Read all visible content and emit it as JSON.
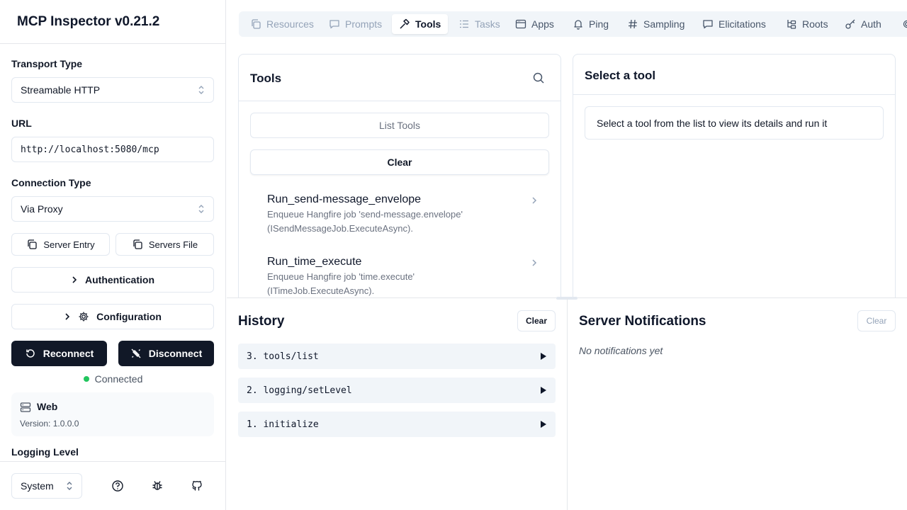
{
  "sidebar": {
    "app_title": "MCP Inspector v0.21.2",
    "transport_label": "Transport Type",
    "transport_value": "Streamable HTTP",
    "url_label": "URL",
    "url_value": "http://localhost:5080/mcp",
    "connection_label": "Connection Type",
    "connection_value": "Via Proxy",
    "server_entry_label": "Server Entry",
    "servers_file_label": "Servers File",
    "authentication_label": "Authentication",
    "configuration_label": "Configuration",
    "reconnect_label": "Reconnect",
    "disconnect_label": "Disconnect",
    "status_text": "Connected",
    "server_name": "Web",
    "server_version": "Version: 1.0.0.0",
    "logging_label": "Logging Level",
    "theme_value": "System"
  },
  "tabs": [
    {
      "label": "Resources",
      "icon": "copy-icon",
      "state": "disabled"
    },
    {
      "label": "Prompts",
      "icon": "message-icon",
      "state": "disabled"
    },
    {
      "label": "Tools",
      "icon": "hammer-icon",
      "state": "active"
    },
    {
      "label": "Tasks",
      "icon": "list-icon",
      "state": "disabled"
    },
    {
      "label": "Apps",
      "icon": "app-window-icon",
      "state": "normal"
    },
    {
      "label": "Ping",
      "icon": "bell-icon",
      "state": "normal"
    },
    {
      "label": "Sampling",
      "icon": "hash-icon",
      "state": "normal"
    },
    {
      "label": "Elicitations",
      "icon": "message-icon",
      "state": "normal"
    },
    {
      "label": "Roots",
      "icon": "folder-tree-icon",
      "state": "normal"
    },
    {
      "label": "Auth",
      "icon": "key-icon",
      "state": "normal"
    }
  ],
  "tools_panel": {
    "title": "Tools",
    "list_tools_label": "List Tools",
    "clear_label": "Clear",
    "items": [
      {
        "name": "Run_send-message_envelope",
        "desc1": "Enqueue Hangfire job 'send-message.envelope'",
        "desc2": "(ISendMessageJob.ExecuteAsync)."
      },
      {
        "name": "Run_time_execute",
        "desc1": "Enqueue Hangfire job 'time.execute'",
        "desc2": "(ITimeJob.ExecuteAsync)."
      }
    ]
  },
  "details_panel": {
    "title": "Select a tool",
    "message": "Select a tool from the list to view its details and run it"
  },
  "history": {
    "title": "History",
    "clear_label": "Clear",
    "items": [
      {
        "label": "3. tools/list"
      },
      {
        "label": "2. logging/setLevel"
      },
      {
        "label": "1. initialize"
      }
    ]
  },
  "notifications": {
    "title": "Server Notifications",
    "clear_label": "Clear",
    "empty_text": "No notifications yet"
  },
  "colors": {
    "accent_dark": "#111827",
    "connected": "#22c55e",
    "border": "#e2e8f0",
    "muted": "#94a3b8"
  }
}
